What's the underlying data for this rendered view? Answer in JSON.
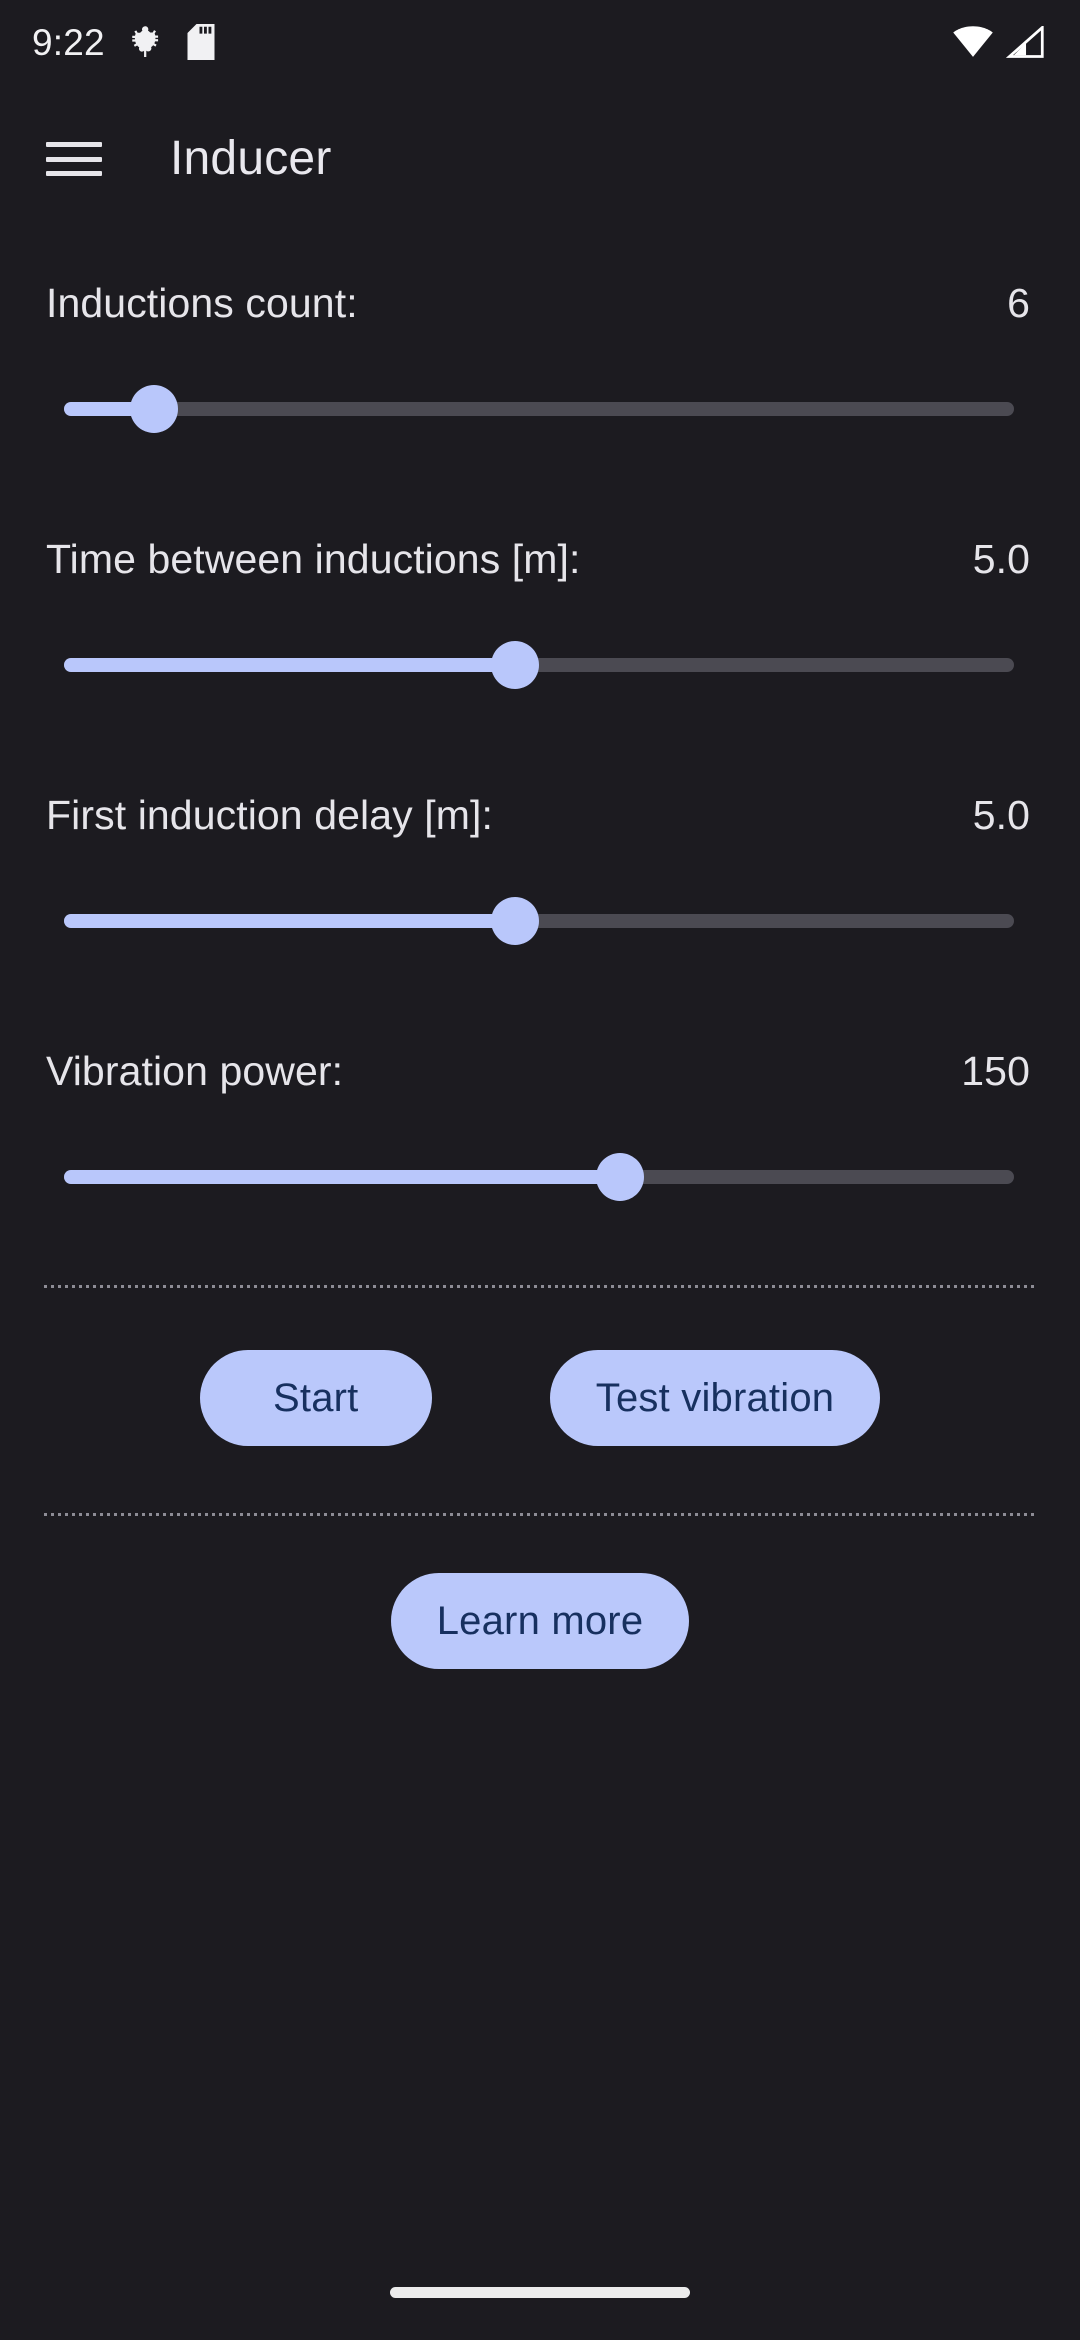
{
  "status_bar": {
    "clock": "9:22",
    "left_icons": [
      {
        "name": "bug-icon",
        "label": "bug"
      },
      {
        "name": "sd-card-icon",
        "label": "sd-card"
      }
    ],
    "right_icons": [
      {
        "name": "wifi-icon",
        "label": "wifi"
      },
      {
        "name": "cellular-signal-icon",
        "label": "cellular-no-sim"
      }
    ]
  },
  "app_bar": {
    "menu_icon": "hamburger-menu-icon",
    "title": "Inducer"
  },
  "settings": [
    {
      "key": "inductions_count",
      "label": "Inductions count:",
      "value": "6",
      "fill_percent": 9.5
    },
    {
      "key": "time_between_inductions",
      "label": "Time between inductions [m]:",
      "value": "5.0",
      "fill_percent": 47.5
    },
    {
      "key": "first_induction_delay",
      "label": "First induction delay [m]:",
      "value": "5.0",
      "fill_percent": 47.5
    },
    {
      "key": "vibration_power",
      "label": "Vibration power:",
      "value": "150",
      "fill_percent": 58.5
    }
  ],
  "actions": {
    "start_label": "Start",
    "test_vibration_label": "Test vibration",
    "learn_more_label": "Learn more"
  },
  "colors": {
    "background": "#1c1b20",
    "accent": "#b9c7fb",
    "accent_text": "#17305f",
    "track_inactive": "#4b4a52",
    "text_primary": "#e6e5ea",
    "divider": "#8d8c95"
  }
}
